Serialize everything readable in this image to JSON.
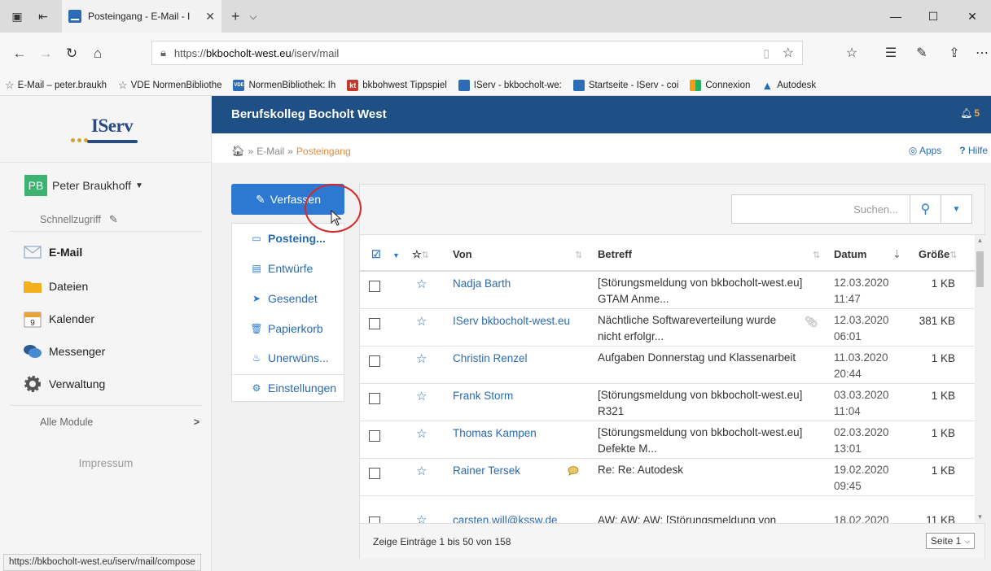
{
  "browser": {
    "tab_title": "Posteingang - E-Mail - I",
    "tab_close": "✕",
    "new_tab": "+",
    "tab_list": "⌵",
    "win_min": "—",
    "win_max": "☐",
    "win_close": "✕",
    "url_prefix": "https://",
    "url_host": "bkbocholt-west.eu",
    "url_path": "/iserv/mail",
    "favorites": [
      {
        "label": "E-Mail – peter.braukh",
        "icon": "star-outline-icon"
      },
      {
        "label": "VDE NormenBibliothe",
        "icon": "star-outline-icon"
      },
      {
        "label": "NormenBibliothek: Ih",
        "icon": "vde-icon"
      },
      {
        "label": "bkbohwest Tippspiel",
        "icon": "kt-icon"
      },
      {
        "label": "IServ - bkbocholt-we:",
        "icon": "iserv-icon"
      },
      {
        "label": "Startseite - IServ - coi",
        "icon": "iserv-icon"
      },
      {
        "label": "Connexion",
        "icon": "connexion-icon"
      },
      {
        "label": "Autodesk",
        "icon": "autodesk-icon"
      }
    ],
    "fav_kt": "kt",
    "fav_vde": "VDE",
    "status_url": "https://bkbocholt-west.eu/iserv/mail/compose"
  },
  "sidebar": {
    "logo": "IServ",
    "user_initials": "PB",
    "user_name": "Peter Braukhoff",
    "quick_access": "Schnellzugriff",
    "nav": [
      {
        "label": "E-Mail",
        "icon": "envelope-icon"
      },
      {
        "label": "Dateien",
        "icon": "folder-icon"
      },
      {
        "label": "Kalender",
        "icon": "calendar-icon"
      },
      {
        "label": "Messenger",
        "icon": "chat-bubbles-icon"
      },
      {
        "label": "Verwaltung",
        "icon": "gear-icon"
      }
    ],
    "calendar_day": "9",
    "all_modules": "Alle Module",
    "impressum": "Impressum"
  },
  "header": {
    "school": "Berufskolleg Bocholt West",
    "notification_count": "5",
    "breadcrumb_home_sep": "»",
    "breadcrumb_section": "E-Mail",
    "breadcrumb_sep": "»",
    "breadcrumb_current": "Posteingang",
    "apps": "Apps",
    "help": "Hilfe"
  },
  "mail": {
    "compose": "Verfassen",
    "folders": [
      {
        "label": "Posteing...",
        "icon": "inbox-icon"
      },
      {
        "label": "Entwürfe",
        "icon": "draft-icon"
      },
      {
        "label": "Gesendet",
        "icon": "send-icon"
      },
      {
        "label": "Papierkorb",
        "icon": "trash-icon"
      },
      {
        "label": "Unerwüns...",
        "icon": "fire-icon"
      }
    ],
    "settings": "Einstellungen",
    "search_placeholder": "Suchen...",
    "columns": {
      "from": "Von",
      "subject": "Betreff",
      "date": "Datum",
      "size": "Größe"
    },
    "rows": [
      {
        "from": "Nadja Barth",
        "subject": "[Störungsmeldung von bkbocholt-west.eu] GTAM Anme...",
        "date": "12.03.2020",
        "time": "11:47",
        "size": "1 KB"
      },
      {
        "from": "IServ bkbocholt-west.eu",
        "subject": "Nächtliche Softwareverteilung wurde nicht erfolgr...",
        "date": "12.03.2020",
        "time": "06:01",
        "size": "381 KB"
      },
      {
        "from": "Christin Renzel",
        "subject": "Aufgaben Donnerstag und Klassenarbeit",
        "date": "11.03.2020",
        "time": "20:44",
        "size": "1 KB"
      },
      {
        "from": "Frank Storm",
        "subject": "[Störungsmeldung von bkbocholt-west.eu] R321",
        "date": "03.03.2020",
        "time": "11:04",
        "size": "1 KB"
      },
      {
        "from": "Thomas Kampen",
        "subject": "[Störungsmeldung von bkbocholt-west.eu] Defekte M...",
        "date": "02.03.2020",
        "time": "13:01",
        "size": "1 KB"
      },
      {
        "from": "Rainer Tersek",
        "subject": "Re: Re: Autodesk",
        "date": "19.02.2020",
        "time": "09:45",
        "size": "1 KB"
      },
      {
        "from": "carsten.will@kssw.de",
        "subject": "AW: AW: AW: [Störungsmeldung von",
        "date": "18.02.2020",
        "time": "",
        "size": "11 KB"
      }
    ],
    "entries_info": "Zeige Einträge 1 bis 50 von 158",
    "page": "Seite 1"
  }
}
